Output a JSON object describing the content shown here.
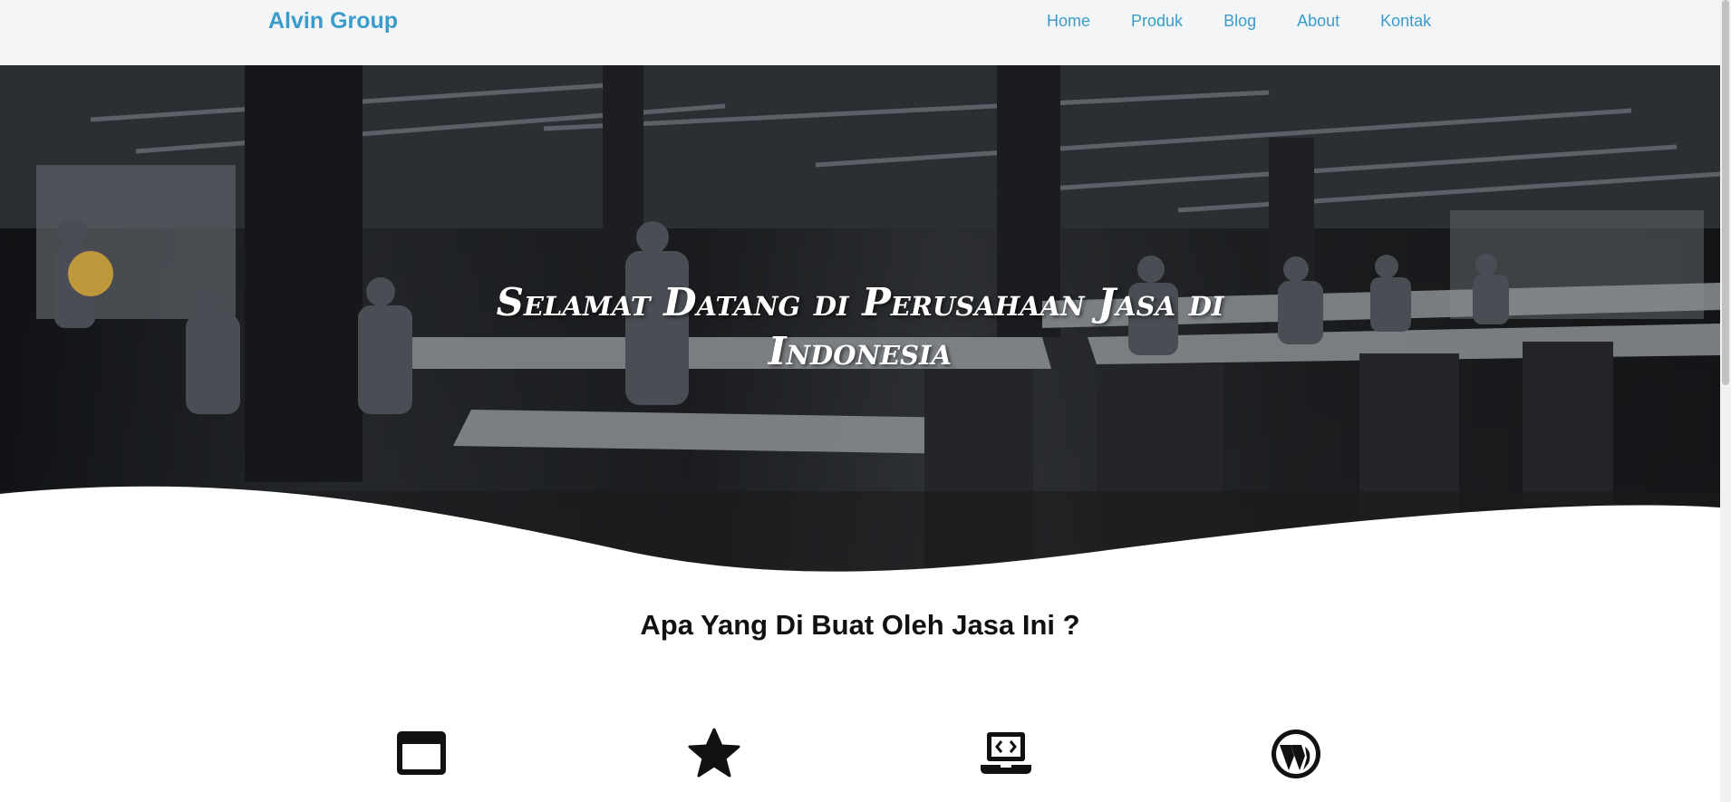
{
  "navbar": {
    "brand": "Alvin Group",
    "links": [
      "Home",
      "Produk",
      "Blog",
      "About",
      "Kontak"
    ]
  },
  "hero": {
    "title_line1": "Selamat Datang di Perusahaan Jasa di",
    "title_line2": "Indonesia"
  },
  "section": {
    "heading": "Apa Yang Di Buat Oleh Jasa Ini ?"
  },
  "features": {
    "icons": [
      "browser-window-icon",
      "star-icon",
      "laptop-code-icon",
      "wordpress-icon"
    ]
  },
  "colors": {
    "brand": "#3b9ccc",
    "navbar_bg": "#f4f5f7",
    "heading": "#111111"
  }
}
